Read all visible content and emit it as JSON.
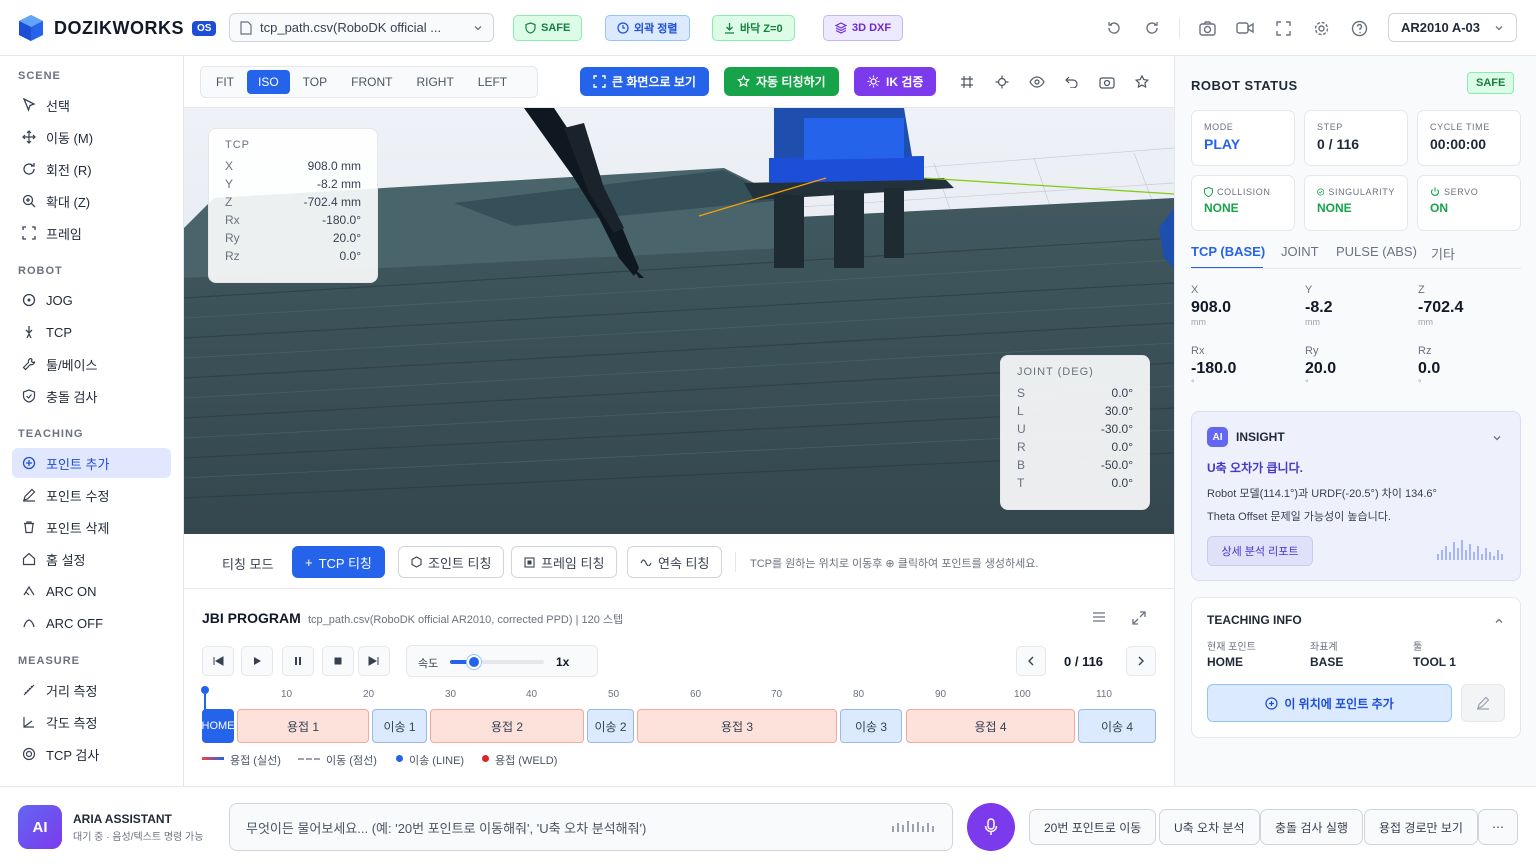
{
  "app": {
    "name": "DOZIKWORKS",
    "os_badge": "OS"
  },
  "header": {
    "file": "tcp_path.csv(RoboDK official ...",
    "pills": [
      "SAFE",
      "외곽 정렬",
      "바닥 Z=0",
      "3D DXF"
    ],
    "robot": "AR2010 A-03"
  },
  "sidebar": {
    "scene_title": "SCENE",
    "scene": [
      "선택",
      "이동 (M)",
      "회전 (R)",
      "확대 (Z)",
      "프레임"
    ],
    "robot_title": "ROBOT",
    "robot": [
      "JOG",
      "TCP",
      "툴/베이스",
      "충돌 검사"
    ],
    "teaching_title": "TEACHING",
    "teaching": [
      "포인트 추가",
      "포인트 수정",
      "포인트 삭제",
      "홈 설정",
      "ARC ON",
      "ARC OFF"
    ],
    "measure_title": "MEASURE",
    "measure": [
      "거리 측정",
      "각도 측정",
      "TCP 검사"
    ]
  },
  "toolbar": {
    "views": [
      "FIT",
      "ISO",
      "TOP",
      "FRONT",
      "RIGHT",
      "LEFT"
    ],
    "fullscreen": "큰 화면으로 보기",
    "auto_teach": "자동 티칭하기",
    "ik": "IK 검증"
  },
  "tcp_card": {
    "title": "TCP",
    "rows": [
      {
        "k": "X",
        "v": "908.0 mm"
      },
      {
        "k": "Y",
        "v": "-8.2 mm"
      },
      {
        "k": "Z",
        "v": "-702.4 mm"
      },
      {
        "k": "Rx",
        "v": "-180.0°"
      },
      {
        "k": "Ry",
        "v": "20.0°"
      },
      {
        "k": "Rz",
        "v": "0.0°"
      }
    ]
  },
  "joint_card": {
    "title": "JOINT (DEG)",
    "rows": [
      {
        "k": "S",
        "v": "0.0°"
      },
      {
        "k": "L",
        "v": "30.0°"
      },
      {
        "k": "U",
        "v": "-30.0°"
      },
      {
        "k": "R",
        "v": "0.0°"
      },
      {
        "k": "B",
        "v": "-50.0°"
      },
      {
        "k": "T",
        "v": "0.0°"
      }
    ]
  },
  "teach_mode": {
    "label": "티칭 모드",
    "buttons": [
      "TCP 티칭",
      "조인트 티칭",
      "프레임 티칭",
      "연속 티칭"
    ],
    "hint": "TCP를 원하는 위치로 이동후 ⊕ 클릭하여 포인트를 생성하세요."
  },
  "program": {
    "title": "JBI PROGRAM",
    "subtitle": "tcp_path.csv(RoboDK official AR2010, corrected PPD) | 120 스텝",
    "speed_label": "속도",
    "speed_value": "1x",
    "speed_fraction": 0.25,
    "step": "0 / 116",
    "ticks": [
      "10",
      "20",
      "30",
      "40",
      "50",
      "60",
      "70",
      "80",
      "90",
      "100",
      "110"
    ],
    "segments": [
      "HOME",
      "용접 1",
      "이송 1",
      "용접 2",
      "이송 2",
      "용접 3",
      "이송 3",
      "용접 4",
      "이송 4"
    ],
    "legend": [
      "용접 (실선)",
      "이동 (점선)",
      "이송 (LINE)",
      "용접 (WELD)"
    ]
  },
  "status": {
    "title": "ROBOT STATUS",
    "badge": "SAFE",
    "mode_label": "MODE",
    "mode": "PLAY",
    "step_label": "STEP",
    "step": "0 / 116",
    "cycle_label": "CYCLE TIME",
    "cycle": "00:00:00",
    "collision_label": "COLLISION",
    "collision": "NONE",
    "singularity_label": "SINGULARITY",
    "singularity": "NONE",
    "servo_label": "SERVO",
    "servo": "ON"
  },
  "coord_tabs": [
    "TCP (BASE)",
    "JOINT",
    "PULSE (ABS)",
    "기타"
  ],
  "coords": [
    {
      "k": "X",
      "v": "908.0",
      "u": "mm"
    },
    {
      "k": "Y",
      "v": "-8.2",
      "u": "mm"
    },
    {
      "k": "Z",
      "v": "-702.4",
      "u": "mm"
    },
    {
      "k": "Rx",
      "v": "-180.0",
      "u": "°"
    },
    {
      "k": "Ry",
      "v": "20.0",
      "u": "°"
    },
    {
      "k": "Rz",
      "v": "0.0",
      "u": "°"
    }
  ],
  "insight": {
    "ai": "AI",
    "title": "INSIGHT",
    "headline": "U축 오차가 큽니다.",
    "line1": "Robot 모델(114.1°)과 URDF(-20.5°) 차이 134.6°",
    "line2": "Theta Offset 문제일 가능성이 높습니다.",
    "button": "상세 분석 리포트"
  },
  "teaching_info": {
    "title": "TEACHING INFO",
    "l1": "현재 포인트",
    "v1": "HOME",
    "l2": "좌표계",
    "v2": "BASE",
    "l3": "툴",
    "v3": "TOOL 1",
    "add": "이 위치에 포인트 추가"
  },
  "assistant": {
    "avatar": "AI",
    "name": "ARIA ASSISTANT",
    "status": "대기 중 · 음성/텍스트 명령 가능",
    "placeholder": "무엇이든 물어보세요... (예: '20번 포인트로 이동해줘', 'U축 오차 분석해줘')",
    "quick": [
      "20번 포인트로 이동",
      "U축 오차 분석",
      "충돌 검사 실행",
      "용접 경로만 보기"
    ]
  },
  "colors": {
    "accent": "#2563eb",
    "green": "#16a34a",
    "purple": "#7c3aed",
    "weld": "#ef4444"
  }
}
